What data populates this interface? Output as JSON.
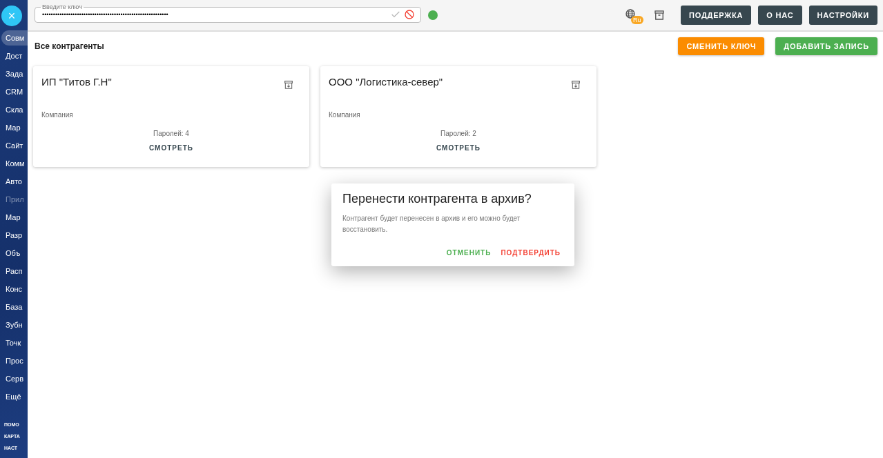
{
  "sidebar": {
    "close_label": "×",
    "items": [
      {
        "label": "Совм",
        "selected": true,
        "disabled": false
      },
      {
        "label": "Дост",
        "selected": false,
        "disabled": false
      },
      {
        "label": "Зада",
        "selected": false,
        "disabled": false
      },
      {
        "label": "CRM",
        "selected": false,
        "disabled": false
      },
      {
        "label": "Скла",
        "selected": false,
        "disabled": false
      },
      {
        "label": "Мар",
        "selected": false,
        "disabled": false
      },
      {
        "label": "Сайт",
        "selected": false,
        "disabled": false
      },
      {
        "label": "Комм",
        "selected": false,
        "disabled": false
      },
      {
        "label": "Авто",
        "selected": false,
        "disabled": false
      },
      {
        "label": "Прил",
        "selected": false,
        "disabled": true
      },
      {
        "label": "Мар",
        "selected": false,
        "disabled": false
      },
      {
        "label": "Разр",
        "selected": false,
        "disabled": false
      },
      {
        "label": "Объ",
        "selected": false,
        "disabled": false
      },
      {
        "label": "Расп",
        "selected": false,
        "disabled": false
      },
      {
        "label": "Конс",
        "selected": false,
        "disabled": false
      },
      {
        "label": "База",
        "selected": false,
        "disabled": false
      },
      {
        "label": "Зубн",
        "selected": false,
        "disabled": false
      },
      {
        "label": "Точк",
        "selected": false,
        "disabled": false
      },
      {
        "label": "Прос",
        "selected": false,
        "disabled": false
      },
      {
        "label": "Серв",
        "selected": false,
        "disabled": false
      },
      {
        "label": "Ещё",
        "selected": false,
        "disabled": false
      }
    ],
    "footer_links": [
      "ПОМО",
      "КАРТА",
      "НАСТ"
    ]
  },
  "top_bar": {
    "key_field": {
      "label": "Введите ключ",
      "value": "••••••••••••••••••••••••••••••••••••••••••••••••••••••••••"
    },
    "connected": true,
    "language_badge": "Ru",
    "buttons": [
      "ПОДДЕРЖКА",
      "О НАС",
      "НАСТРОЙКИ"
    ]
  },
  "page": {
    "title": "Все контрагенты",
    "change_key_button": "СМЕНИТЬ КЛЮЧ",
    "add_button": "ДОБАВИТЬ ЗАПИСЬ"
  },
  "cards": [
    {
      "name": "ИП \"Титов Г.Н\"",
      "type": "Компания",
      "passwords": "Паролей: 4",
      "action": "СМОТРЕТЬ"
    },
    {
      "name": "ООО \"Логистика-север\"",
      "type": "Компания",
      "passwords": "Паролей: 2",
      "action": "СМОТРЕТЬ"
    }
  ],
  "dialog": {
    "title": "Перенести контрагента в архив?",
    "text": "Контрагент будет перенесен в архив и его можно будет восстановить.",
    "cancel": "ОТМЕНИТЬ",
    "confirm": "ПОДТВЕРДИТЬ"
  }
}
